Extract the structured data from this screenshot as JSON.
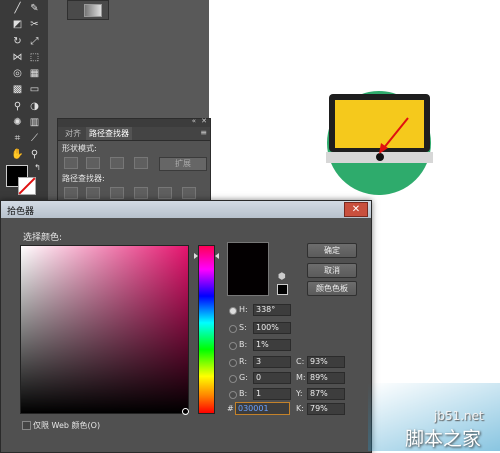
{
  "toolbar": {
    "tools": [
      "pen-tool",
      "brush-tool",
      "pencil-tool",
      "eraser-tool",
      "rotate-tool",
      "scale-tool",
      "width-tool",
      "free-transform-tool",
      "shape-builder-tool",
      "perspective-tool",
      "mesh-tool",
      "gradient-tool",
      "eyedropper-tool",
      "blend-tool",
      "symbol-sprayer-tool",
      "column-graph-tool",
      "artboard-tool",
      "slice-tool",
      "hand-tool",
      "zoom-tool"
    ]
  },
  "pathfinder": {
    "tab_align": "对齐",
    "tab_pathfinder": "路径查找器",
    "shape_modes_label": "形状模式:",
    "expand_label": "扩展",
    "pathfinders_label": "路径查找器:"
  },
  "picker": {
    "title": "拾色器",
    "select_color_label": "选择颜色:",
    "ok_label": "确定",
    "cancel_label": "取消",
    "swatches_label": "颜色色板",
    "web_only_label": "仅限 Web 颜色(O)",
    "new_color_hex": "#030001",
    "fields": {
      "h_label": "H:",
      "h_value": "338°",
      "s_label": "S:",
      "s_value": "100%",
      "b_label": "B:",
      "b_value": "1%",
      "r_label": "R:",
      "r_value": "3",
      "g_label": "G:",
      "g_value": "0",
      "bl_label": "B:",
      "bl_value": "1",
      "c_label": "C:",
      "c_value": "93%",
      "m_label": "M:",
      "m_value": "89%",
      "y_label": "Y:",
      "y_value": "87%",
      "k_label": "K:",
      "k_value": "79%",
      "hex_label": "#",
      "hex_value": "030001"
    }
  },
  "illustration": {
    "circle_color": "#2eab6c",
    "screen_color": "#f5c91c",
    "arrow_color": "#e01010"
  },
  "watermark": {
    "site": "jb51.net",
    "brand": "脚本之家"
  }
}
